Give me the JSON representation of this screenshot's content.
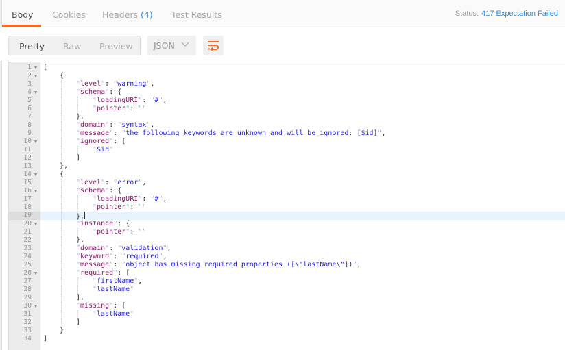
{
  "tabs": [
    {
      "label": "Body",
      "active": true
    },
    {
      "label": "Cookies",
      "active": false
    },
    {
      "label": "Headers",
      "count": "(4)",
      "active": false
    },
    {
      "label": "Test Results",
      "active": false
    }
  ],
  "status": {
    "label": "Status:",
    "value": "417 Expectation Failed"
  },
  "colors": {
    "accent": "#f26b21",
    "link": "#2e8de4",
    "key": "#8a1f6a",
    "string": "#2525d8"
  },
  "view_modes": [
    {
      "label": "Pretty",
      "active": true
    },
    {
      "label": "Raw",
      "active": false
    },
    {
      "label": "Preview",
      "active": false
    }
  ],
  "format_select": {
    "value": "JSON",
    "icon": "chevron-down-icon"
  },
  "wrap_button": {
    "icon": "wrap-lines-icon"
  },
  "editor": {
    "active_line": 19,
    "lines": [
      {
        "n": "1",
        "fold": true,
        "indent": 0,
        "tokens": [
          [
            "p",
            "["
          ]
        ]
      },
      {
        "n": "2",
        "fold": true,
        "indent": 1,
        "tokens": [
          [
            "p",
            "{"
          ]
        ]
      },
      {
        "n": "3",
        "fold": false,
        "indent": 2,
        "tokens": [
          [
            "k",
            "level"
          ],
          [
            "p",
            ": "
          ],
          [
            "s",
            "warning"
          ],
          [
            "p",
            ","
          ]
        ]
      },
      {
        "n": "4",
        "fold": true,
        "indent": 2,
        "tokens": [
          [
            "k",
            "schema"
          ],
          [
            "p",
            ": {"
          ]
        ]
      },
      {
        "n": "5",
        "fold": false,
        "indent": 3,
        "tokens": [
          [
            "k",
            "loadingURI"
          ],
          [
            "p",
            ": "
          ],
          [
            "s",
            "#"
          ],
          [
            "p",
            ","
          ]
        ]
      },
      {
        "n": "6",
        "fold": false,
        "indent": 3,
        "tokens": [
          [
            "k",
            "pointer"
          ],
          [
            "p",
            ": "
          ],
          [
            "s",
            ""
          ]
        ]
      },
      {
        "n": "7",
        "fold": false,
        "indent": 2,
        "tokens": [
          [
            "p",
            "},"
          ]
        ]
      },
      {
        "n": "8",
        "fold": false,
        "indent": 2,
        "tokens": [
          [
            "k",
            "domain"
          ],
          [
            "p",
            ": "
          ],
          [
            "s",
            "syntax"
          ],
          [
            "p",
            ","
          ]
        ]
      },
      {
        "n": "9",
        "fold": false,
        "indent": 2,
        "tokens": [
          [
            "k",
            "message"
          ],
          [
            "p",
            ": "
          ],
          [
            "s",
            "the following keywords are unknown and will be ignored: [$id]"
          ],
          [
            "p",
            ","
          ]
        ]
      },
      {
        "n": "10",
        "fold": true,
        "indent": 2,
        "tokens": [
          [
            "k",
            "ignored"
          ],
          [
            "p",
            ": ["
          ]
        ]
      },
      {
        "n": "11",
        "fold": false,
        "indent": 3,
        "tokens": [
          [
            "s",
            "$id"
          ]
        ]
      },
      {
        "n": "12",
        "fold": false,
        "indent": 2,
        "tokens": [
          [
            "p",
            "]"
          ]
        ]
      },
      {
        "n": "13",
        "fold": false,
        "indent": 1,
        "tokens": [
          [
            "p",
            "},"
          ]
        ]
      },
      {
        "n": "14",
        "fold": true,
        "indent": 1,
        "tokens": [
          [
            "p",
            "{"
          ]
        ]
      },
      {
        "n": "15",
        "fold": false,
        "indent": 2,
        "tokens": [
          [
            "k",
            "level"
          ],
          [
            "p",
            ": "
          ],
          [
            "s",
            "error"
          ],
          [
            "p",
            ","
          ]
        ]
      },
      {
        "n": "16",
        "fold": true,
        "indent": 2,
        "tokens": [
          [
            "k",
            "schema"
          ],
          [
            "p",
            ": {"
          ]
        ]
      },
      {
        "n": "17",
        "fold": false,
        "indent": 3,
        "tokens": [
          [
            "k",
            "loadingURI"
          ],
          [
            "p",
            ": "
          ],
          [
            "s",
            "#"
          ],
          [
            "p",
            ","
          ]
        ]
      },
      {
        "n": "18",
        "fold": false,
        "indent": 3,
        "tokens": [
          [
            "k",
            "pointer"
          ],
          [
            "p",
            ": "
          ],
          [
            "s",
            ""
          ]
        ]
      },
      {
        "n": "19",
        "fold": false,
        "indent": 2,
        "tokens": [
          [
            "p",
            "},"
          ]
        ],
        "cursor": true
      },
      {
        "n": "20",
        "fold": true,
        "indent": 2,
        "tokens": [
          [
            "k",
            "instance"
          ],
          [
            "p",
            ": {"
          ]
        ]
      },
      {
        "n": "21",
        "fold": false,
        "indent": 3,
        "tokens": [
          [
            "k",
            "pointer"
          ],
          [
            "p",
            ": "
          ],
          [
            "s",
            ""
          ]
        ]
      },
      {
        "n": "22",
        "fold": false,
        "indent": 2,
        "tokens": [
          [
            "p",
            "},"
          ]
        ]
      },
      {
        "n": "23",
        "fold": false,
        "indent": 2,
        "tokens": [
          [
            "k",
            "domain"
          ],
          [
            "p",
            ": "
          ],
          [
            "s",
            "validation"
          ],
          [
            "p",
            ","
          ]
        ]
      },
      {
        "n": "24",
        "fold": false,
        "indent": 2,
        "tokens": [
          [
            "k",
            "keyword"
          ],
          [
            "p",
            ": "
          ],
          [
            "s",
            "required"
          ],
          [
            "p",
            ","
          ]
        ]
      },
      {
        "n": "25",
        "fold": false,
        "indent": 2,
        "tokens": [
          [
            "k",
            "message"
          ],
          [
            "p",
            ": "
          ],
          [
            "s",
            "object has missing required properties ([\\\"lastName\\\"])"
          ],
          [
            "p",
            ","
          ]
        ]
      },
      {
        "n": "26",
        "fold": true,
        "indent": 2,
        "tokens": [
          [
            "k",
            "required"
          ],
          [
            "p",
            ": ["
          ]
        ]
      },
      {
        "n": "27",
        "fold": false,
        "indent": 3,
        "tokens": [
          [
            "s",
            "firstName"
          ],
          [
            "p",
            ","
          ]
        ]
      },
      {
        "n": "28",
        "fold": false,
        "indent": 3,
        "tokens": [
          [
            "s",
            "lastName"
          ]
        ]
      },
      {
        "n": "29",
        "fold": false,
        "indent": 2,
        "tokens": [
          [
            "p",
            "],"
          ]
        ]
      },
      {
        "n": "30",
        "fold": true,
        "indent": 2,
        "tokens": [
          [
            "k",
            "missing"
          ],
          [
            "p",
            ": ["
          ]
        ]
      },
      {
        "n": "31",
        "fold": false,
        "indent": 3,
        "tokens": [
          [
            "s",
            "lastName"
          ]
        ]
      },
      {
        "n": "32",
        "fold": false,
        "indent": 2,
        "tokens": [
          [
            "p",
            "]"
          ]
        ]
      },
      {
        "n": "33",
        "fold": false,
        "indent": 1,
        "tokens": [
          [
            "p",
            "}"
          ]
        ]
      },
      {
        "n": "34",
        "fold": false,
        "indent": 0,
        "tokens": [
          [
            "p",
            "]"
          ]
        ]
      }
    ]
  }
}
